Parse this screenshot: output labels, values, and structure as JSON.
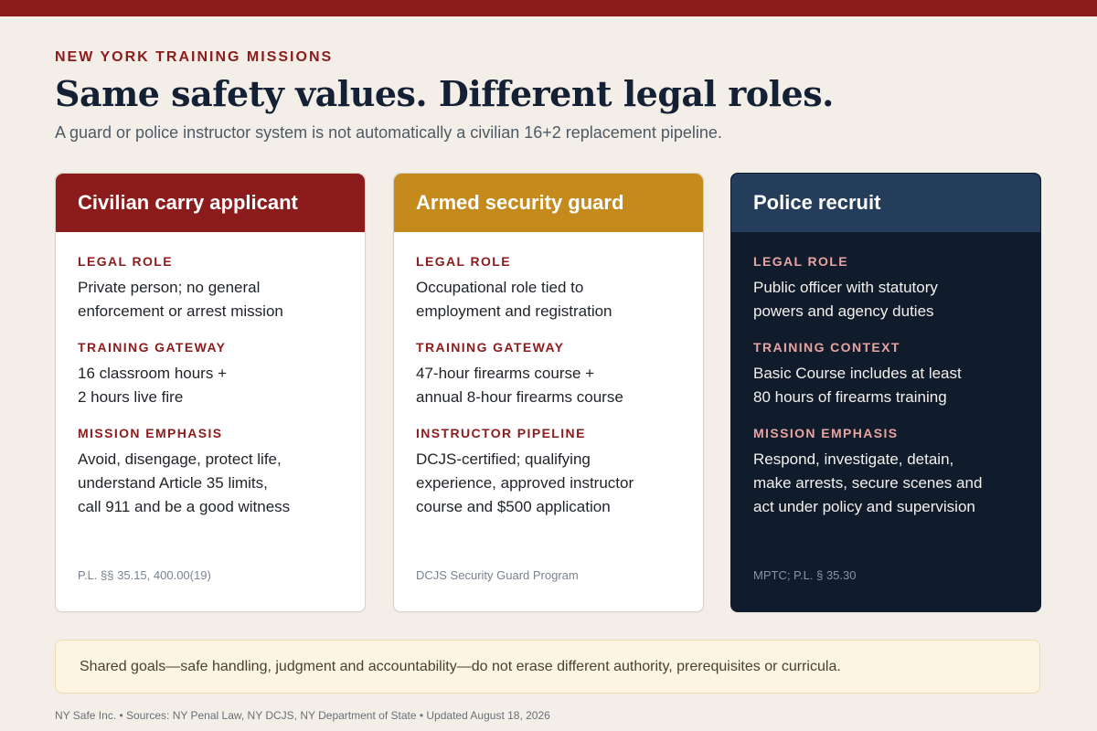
{
  "eyebrow": "NEW YORK TRAINING MISSIONS",
  "headline": "Same safety values. Different legal roles.",
  "subhead": "A guard or police instructor system is not automatically a civilian 16+2 replacement pipeline.",
  "colors": {
    "brand_red": "#8c1b1c",
    "guard_gold": "#c48a1c",
    "police_navy": "#233d5a",
    "police_dark": "#101b2c",
    "background": "#f3efe8",
    "note_bg": "#fdf5e2"
  },
  "cards": [
    {
      "title": "Civilian carry applicant",
      "sections": [
        {
          "label": "LEGAL ROLE",
          "text": "Private person; no general\nenforcement or arrest mission"
        },
        {
          "label": "TRAINING GATEWAY",
          "text": "16 classroom hours +\n2 hours live fire"
        },
        {
          "label": "MISSION EMPHASIS",
          "text": "Avoid, disengage, protect life,\nunderstand Article 35 limits,\ncall 911 and be a good witness"
        }
      ],
      "source": "P.L. §§ 35.15, 400.00(19)"
    },
    {
      "title": "Armed security guard",
      "sections": [
        {
          "label": "LEGAL ROLE",
          "text": "Occupational role tied to\nemployment and registration"
        },
        {
          "label": "TRAINING GATEWAY",
          "text": "47-hour firearms course +\nannual 8-hour firearms course"
        },
        {
          "label": "INSTRUCTOR PIPELINE",
          "text": "DCJS-certified; qualifying\nexperience, approved instructor\ncourse and $500 application"
        }
      ],
      "source": "DCJS Security Guard Program"
    },
    {
      "title": "Police recruit",
      "sections": [
        {
          "label": "LEGAL ROLE",
          "text": "Public officer with statutory\npowers and agency duties"
        },
        {
          "label": "TRAINING CONTEXT",
          "text": "Basic Course includes at least\n80 hours of firearms training"
        },
        {
          "label": "MISSION EMPHASIS",
          "text": "Respond, investigate, detain,\nmake arrests, secure scenes and\nact under policy and supervision"
        }
      ],
      "source": "MPTC; P.L. § 35.30"
    }
  ],
  "note": "Shared goals—safe handling, judgment and accountability—do not erase different authority, prerequisites or curricula.",
  "footer": "NY Safe Inc. • Sources: NY Penal Law, NY DCJS, NY Department of State • Updated August 18, 2026"
}
